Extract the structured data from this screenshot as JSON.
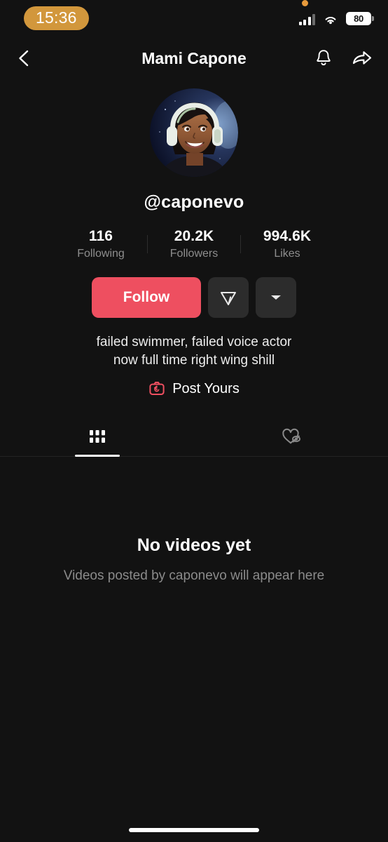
{
  "status_bar": {
    "time": "15:36",
    "battery_percent": "80",
    "recording_dot": "recording-indicator-dot",
    "signal_icon": "cellular-signal-icon",
    "wifi_icon": "wifi-icon",
    "battery_icon": "battery-icon",
    "time_pill_color": "#D2973C"
  },
  "header": {
    "title": "Mami Capone",
    "back_icon": "back-chevron-icon",
    "notify_icon": "bell-icon",
    "share_icon": "share-arrow-icon"
  },
  "profile": {
    "avatar_alt": "avatar-photo",
    "username": "@caponevo",
    "stats": [
      {
        "value": "116",
        "label": "Following"
      },
      {
        "value": "20.2K",
        "label": "Followers"
      },
      {
        "value": "994.6K",
        "label": "Likes"
      }
    ],
    "follow_label": "Follow",
    "message_icon": "send-message-icon",
    "more_icon": "chevron-down-icon",
    "bio_line1": "failed swimmer, failed voice actor",
    "bio_line2": "now full time right wing shill",
    "post_yours_label": "Post Yours",
    "post_yours_icon": "camera-icon",
    "accent_color": "#EE4F60"
  },
  "tabs": [
    {
      "name": "videos-grid",
      "icon": "grid-icon",
      "active": true
    },
    {
      "name": "liked-private",
      "icon": "heart-hidden-icon",
      "active": false
    }
  ],
  "empty_state": {
    "title": "No videos yet",
    "subtitle": "Videos posted by caponevo will appear here"
  },
  "home_indicator": "home-indicator-bar"
}
